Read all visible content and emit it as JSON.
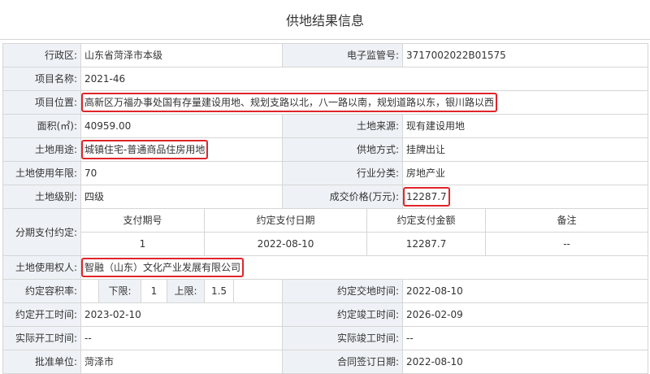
{
  "title": "供地结果信息",
  "rows": {
    "region_label": "行政区:",
    "region_value": "山东省菏泽市本级",
    "code_label": "电子监管号:",
    "code_value": "3717002022B01575",
    "project_name_label": "项目名称:",
    "project_name_value": "2021-46",
    "location_label": "项目位置:",
    "location_value": "高新区万福办事处国有存量建设用地、规划支路以北，八一路以南，规划道路以东，银川路以西",
    "area_label": "面积(㎡):",
    "area_value": "40959.00",
    "source_label": "土地来源:",
    "source_value": "现有建设用地",
    "usage_label": "土地用途:",
    "usage_value": "城镇住宅-普通商品住房用地",
    "supply_method_label": "供地方式:",
    "supply_method_value": "挂牌出让",
    "years_label": "土地使用年限:",
    "years_value": "70",
    "industry_label": "行业分类:",
    "industry_value": "房地产业",
    "grade_label": "土地级别:",
    "grade_value": "四级",
    "price_label": "成交价格(万元):",
    "price_value": "12287.7",
    "installment_label": "分期支付约定:",
    "installment_headers": [
      "支付期号",
      "约定支付日期",
      "约定支付金额",
      "备注"
    ],
    "installment_row": [
      "1",
      "2022-08-10",
      "12287.7",
      "--"
    ],
    "user_label": "土地使用权人:",
    "user_value": "智融（山东）文化产业发展有限公司",
    "far_label": "约定容积率:",
    "far_lower_label": "下限:",
    "far_lower_value": "1",
    "far_upper_label": "上限:",
    "far_upper_value": "1.5",
    "delivery_label": "约定交地时间:",
    "delivery_value": "2022-08-10",
    "start_label": "约定开工时间:",
    "start_value": "2023-02-10",
    "finish_label": "约定竣工时间:",
    "finish_value": "2026-02-09",
    "actual_start_label": "实际开工时间:",
    "actual_start_value": "--",
    "actual_finish_label": "实际竣工时间:",
    "actual_finish_value": "--",
    "approver_label": "批准单位:",
    "approver_value": "菏泽市",
    "contract_label": "合同签订日期:",
    "contract_value": "2022-08-10"
  },
  "highlight_color": "#e0252a"
}
